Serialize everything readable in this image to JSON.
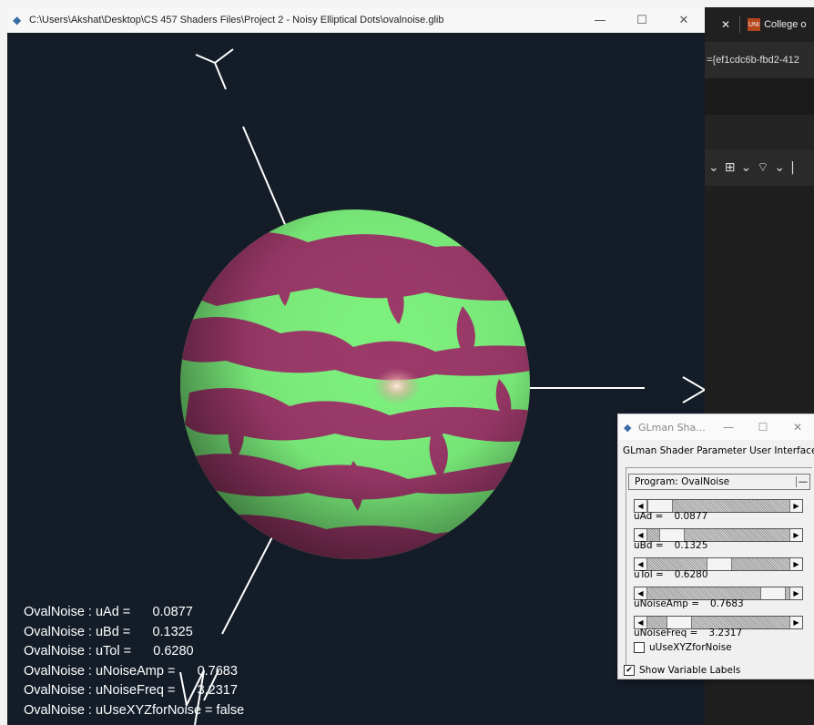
{
  "main_window": {
    "title": "C:\\Users\\Akshat\\Desktop\\CS 457 Shaders Files\\Project 2 - Noisy Elliptical Dots\\ovalnoise.glib",
    "controls": {
      "minimize": "—",
      "maximize": "☐",
      "close": "✕"
    }
  },
  "background_app": {
    "tab_close": "✕",
    "tab_title": "College o",
    "tab_favicon": "UNI",
    "url_text": "={ef1cdc6b-fbd2-412",
    "toolbar_items": [
      "⌄",
      "⊞",
      "⌄",
      "⌔",
      "⌄",
      "|"
    ]
  },
  "overlay": {
    "lines": [
      "OvalNoise : uAd =      0.0877",
      "OvalNoise : uBd =      0.1325",
      "OvalNoise : uTol =      0.6280",
      "OvalNoise : uNoiseAmp =      0.7683",
      "OvalNoise : uNoiseFreq =      3.2317",
      "OvalNoise : uUseXYZforNoise = false"
    ]
  },
  "glman": {
    "title": "GLman Sha...",
    "controls": {
      "minimize": "—",
      "maximize": "☐",
      "close": "✕"
    },
    "header": "GLman Shader Parameter User Interface",
    "program_label": "Program: OvalNoise",
    "program_button": "—",
    "arrow_left": "◀",
    "arrow_right": "▶",
    "sliders": [
      {
        "name": "uAd =",
        "value": "0.0877",
        "level": 0.0
      },
      {
        "name": "uBd =",
        "value": "0.1325",
        "level": 0.1
      },
      {
        "name": "uTol =",
        "value": "0.6280",
        "level": 0.5
      },
      {
        "name": "uNoiseAmp =",
        "value": "0.7683",
        "level": 0.95
      },
      {
        "name": "uNoiseFreq =",
        "value": "3.2317",
        "level": 0.16
      }
    ],
    "checkbox_xyz": {
      "label": "uUseXYZforNoise",
      "checked": false
    },
    "checkbox_labels": {
      "label": "Show Variable Labels",
      "checked": true,
      "mark": "✔"
    }
  },
  "colors": {
    "background": "#141c28",
    "sphere_green": "#7cf07c",
    "sphere_magenta": "#9b3868",
    "axis": "#ffffff"
  }
}
